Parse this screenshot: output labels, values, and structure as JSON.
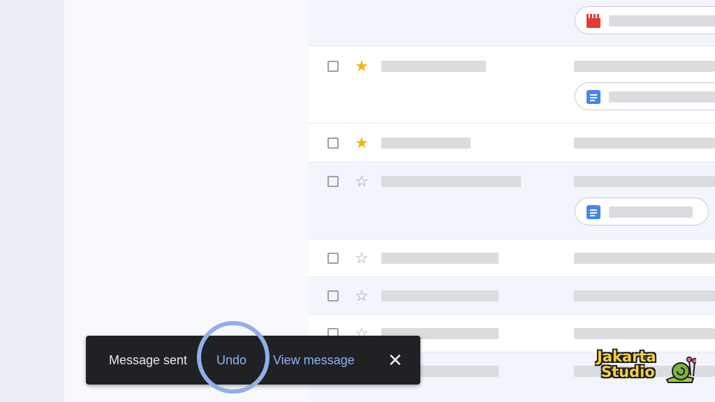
{
  "inbox": {
    "rows": [
      {
        "type": "attachment-strip",
        "attachment": "video-icon"
      },
      {
        "type": "email",
        "starred": true,
        "attachment": "doc-icon"
      },
      {
        "type": "email",
        "starred": true
      },
      {
        "type": "email",
        "starred": false,
        "attachment": "doc-icon"
      },
      {
        "type": "email",
        "starred": false
      },
      {
        "type": "email",
        "starred": false
      },
      {
        "type": "email",
        "starred": false
      },
      {
        "type": "email",
        "starred": false
      }
    ]
  },
  "snackbar": {
    "message": "Message sent",
    "undo_label": "Undo",
    "view_label": "View message",
    "close_glyph": "✕"
  },
  "icons": {
    "star_filled": "★",
    "star_empty": "☆"
  },
  "watermark": {
    "line1": "Jakarta",
    "line2": "Studio"
  },
  "colors": {
    "star": "#f4b400",
    "snackbar_bg": "#202124",
    "snackbar_action": "#8ab4f8",
    "highlight_ring": "#8fb0e8",
    "doc_icon": "#4285f4",
    "video_icon": "#e53935"
  }
}
